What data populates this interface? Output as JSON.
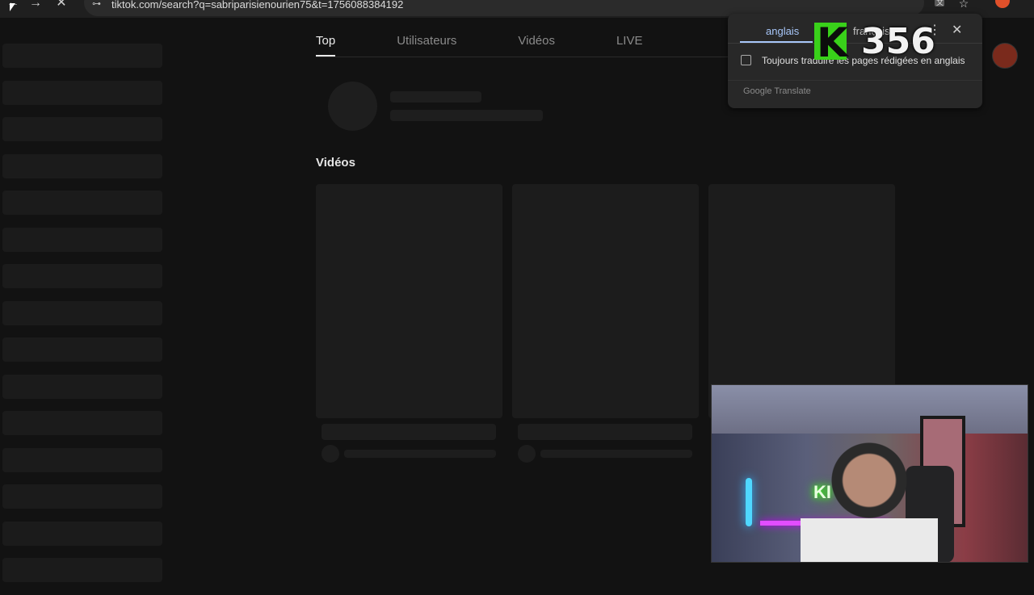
{
  "browser": {
    "url": "tiktok.com/search?q=sabriparisienourien75&t=1756088384192",
    "nav_back": "←",
    "nav_forward": "→",
    "nav_stop": "✕",
    "url_icon": "⊶",
    "translate_icon": "translate-icon",
    "star_icon": "☆"
  },
  "tabs": [
    {
      "label": "Top",
      "active": true
    },
    {
      "label": "Utilisateurs",
      "active": false
    },
    {
      "label": "Vidéos",
      "active": false
    },
    {
      "label": "LIVE",
      "active": false
    }
  ],
  "section": {
    "videos_title": "Vidéos"
  },
  "translate_popup": {
    "tab_source": "anglais",
    "tab_target": "français",
    "more_icon": "⋮",
    "close_icon": "✕",
    "checkbox_label": "Toujours traduire les pages rédigées en anglais",
    "brand": "Google Translate"
  },
  "overlay": {
    "badge_letter": "K",
    "count": "356"
  },
  "webcam": {
    "sign_text": "KI"
  },
  "colors": {
    "background": "#121212",
    "skeleton": "#1c1c1c",
    "accent_blue": "#a8c7fa",
    "kick_green": "#39d11a"
  }
}
